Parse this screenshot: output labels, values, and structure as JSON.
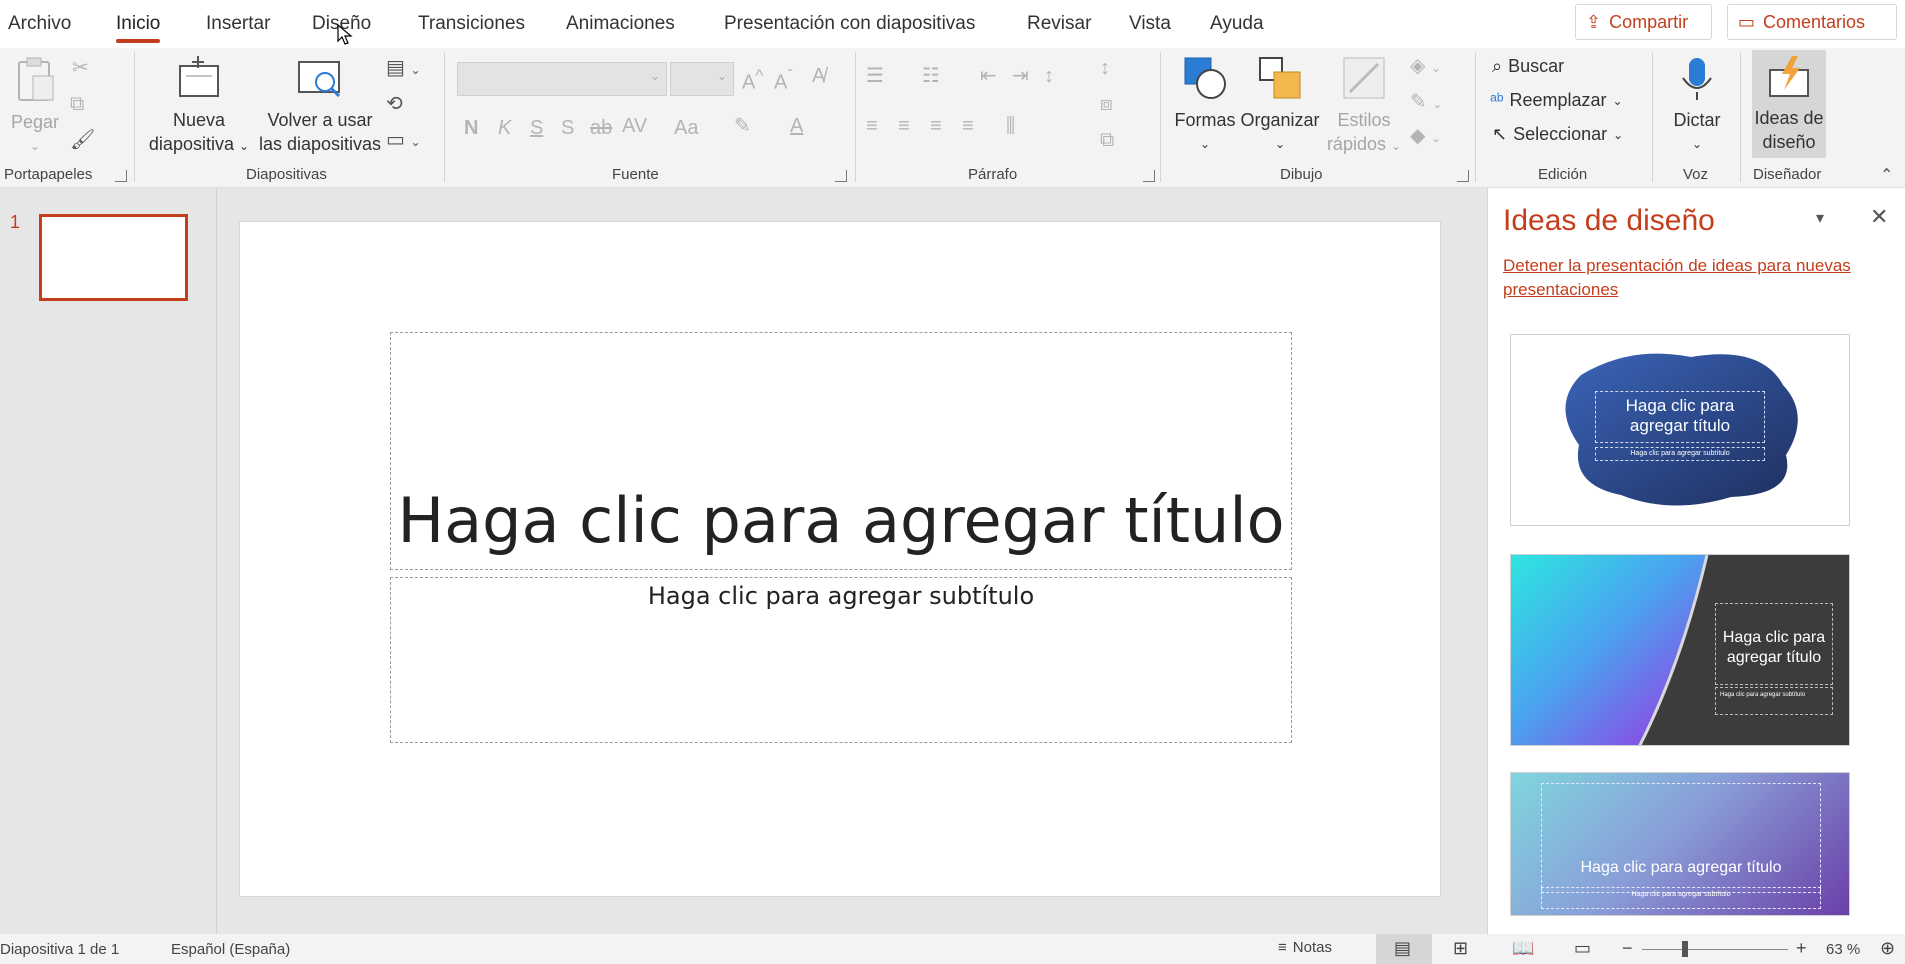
{
  "tabs": [
    "Archivo",
    "Inicio",
    "Insertar",
    "Diseño",
    "Transiciones",
    "Animaciones",
    "Presentación con diapositivas",
    "Revisar",
    "Vista",
    "Ayuda"
  ],
  "active_tab": "Inicio",
  "top_buttons": {
    "share": "Compartir",
    "comments": "Comentarios"
  },
  "ribbon": {
    "portapapeles": {
      "label": "Portapapeles",
      "paste": "Pegar"
    },
    "diapositivas": {
      "label": "Diapositivas",
      "new_slide_1": "Nueva",
      "new_slide_2": "diapositiva",
      "reuse_1": "Volver a usar",
      "reuse_2": "las diapositivas"
    },
    "fuente": {
      "label": "Fuente",
      "bold": "N",
      "italic": "K",
      "underline": "S",
      "shadow": "S",
      "strike": "ab",
      "spacing": "AV",
      "case": "Aa"
    },
    "parrafo": {
      "label": "Párrafo"
    },
    "dibujo": {
      "label": "Dibujo",
      "shapes": "Formas",
      "arrange": "Organizar",
      "quick_1": "Estilos",
      "quick_2": "rápidos"
    },
    "edicion": {
      "label": "Edición",
      "find": "Buscar",
      "replace": "Reemplazar",
      "select": "Seleccionar"
    },
    "voz": {
      "label": "Voz",
      "dictate": "Dictar"
    },
    "disenador": {
      "label": "Diseñador",
      "ideas_1": "Ideas de",
      "ideas_2": "diseño"
    }
  },
  "thumbnails": {
    "slide_number": "1"
  },
  "slide": {
    "title": "Haga clic para agregar título",
    "subtitle": "Haga clic para agregar subtítulo"
  },
  "design_pane": {
    "title": "Ideas de diseño",
    "stop_link": "Detener la presentación de ideas para nuevas presentaciones",
    "ideas": [
      {
        "title": "Haga clic para agregar título",
        "subtitle": "Haga clic para agregar subtítulo"
      },
      {
        "title": "Haga clic para agregar título",
        "subtitle": "Haga clic para agregar subtítulo"
      },
      {
        "title": "Haga clic para agregar título",
        "subtitle": "Haga clic para agregar subtítulo"
      }
    ]
  },
  "status": {
    "slide_info": "Diapositiva 1 de 1",
    "language": "Español (España)",
    "notes": "Notas",
    "zoom": "63 %"
  },
  "colors": {
    "accent": "#c43e1c",
    "ribbon_bg": "#f3f3f3",
    "canvas_bg": "#e6e6e6"
  }
}
